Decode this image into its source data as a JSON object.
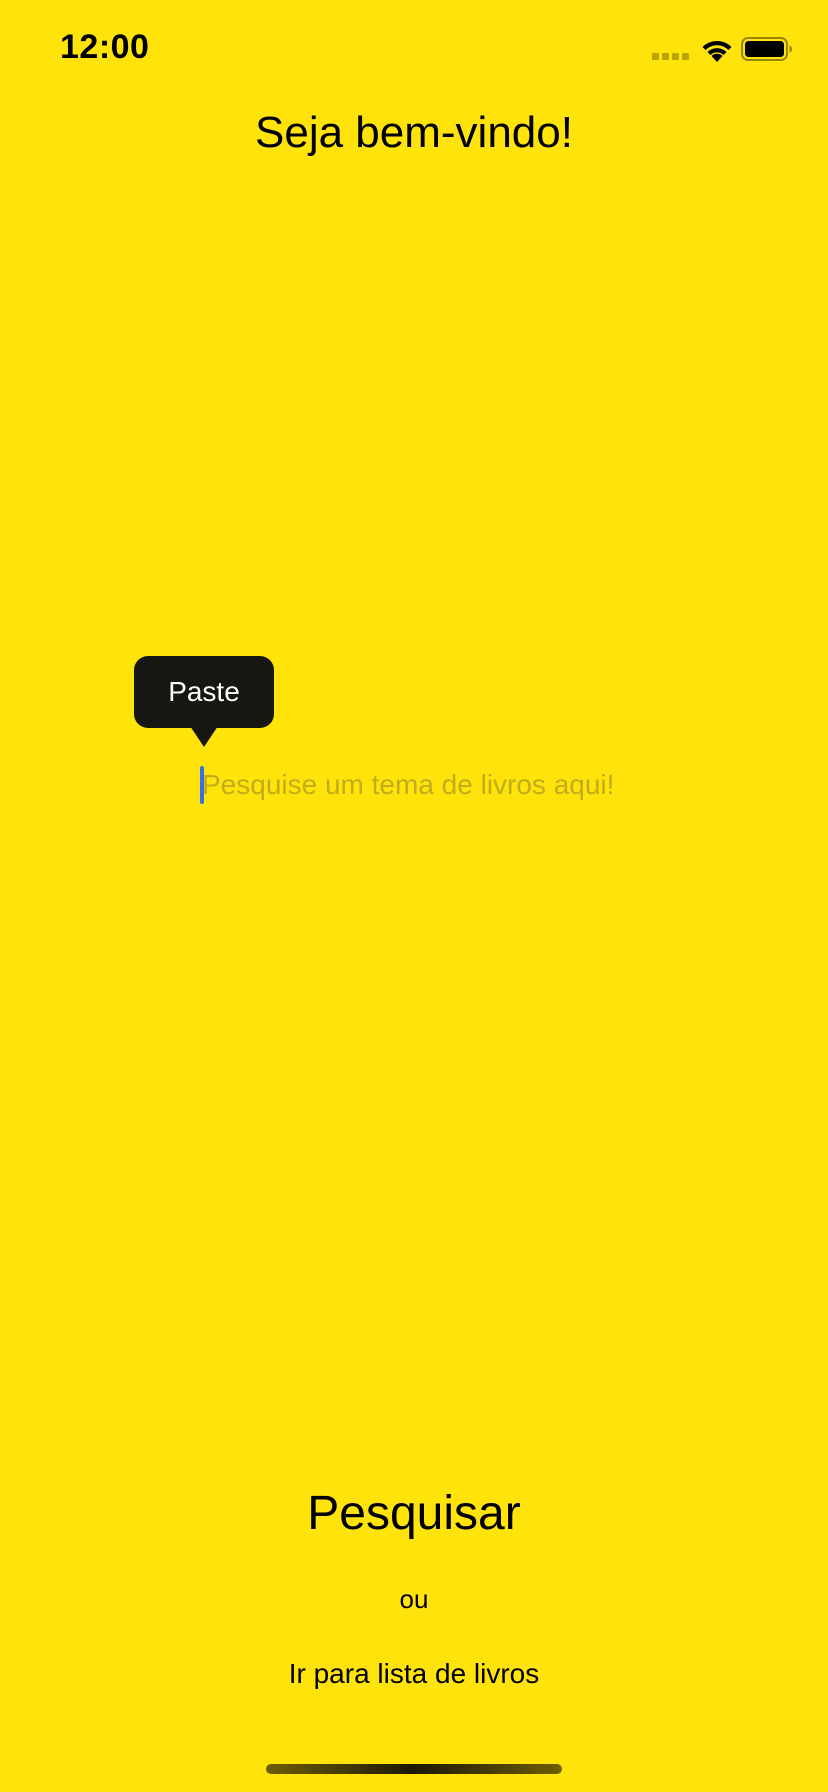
{
  "status_bar": {
    "time": "12:00",
    "icons": [
      "cellular-signal-icon",
      "wifi-icon",
      "battery-icon"
    ]
  },
  "header": {
    "title": "Seja bem-vindo!"
  },
  "context_menu": {
    "paste_label": "Paste"
  },
  "search": {
    "placeholder": "Pesquise um tema de livros aqui!",
    "value": ""
  },
  "actions": {
    "search_label": "Pesquisar",
    "or_label": "ou",
    "list_link_label": "Ir para lista de livros"
  },
  "colors": {
    "background": "#FFE30A",
    "text": "#000000",
    "popup_background": "#161612",
    "cursor": "#3C6FE0"
  }
}
